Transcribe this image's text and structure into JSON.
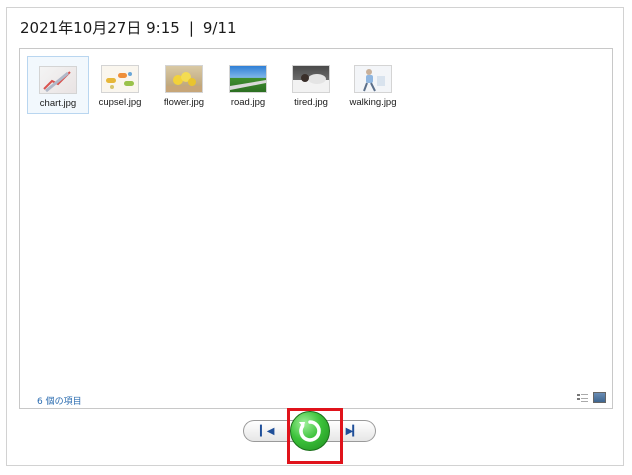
{
  "header": {
    "datetime": "2021年10月27日 9:15",
    "separator": "|",
    "position": "9/11"
  },
  "files": [
    {
      "name": "chart.jpg",
      "icon": "chart-thumbnail",
      "selected": true
    },
    {
      "name": "cupsel.jpg",
      "icon": "capsule-thumbnail",
      "selected": false
    },
    {
      "name": "flower.jpg",
      "icon": "flower-thumbnail",
      "selected": false
    },
    {
      "name": "road.jpg",
      "icon": "road-thumbnail",
      "selected": false
    },
    {
      "name": "tired.jpg",
      "icon": "tired-thumbnail",
      "selected": false
    },
    {
      "name": "walking.jpg",
      "icon": "walking-thumbnail",
      "selected": false
    }
  ],
  "status": {
    "item_count": "6 個の項目"
  },
  "controls": {
    "prev_icon": "skip-previous-icon",
    "rotate_icon": "rotate-icon",
    "next_icon": "skip-next-icon"
  },
  "colors": {
    "highlight": "#e0131b",
    "rotate_green": "#3cc23a",
    "count_text": "#2b6cb0"
  }
}
